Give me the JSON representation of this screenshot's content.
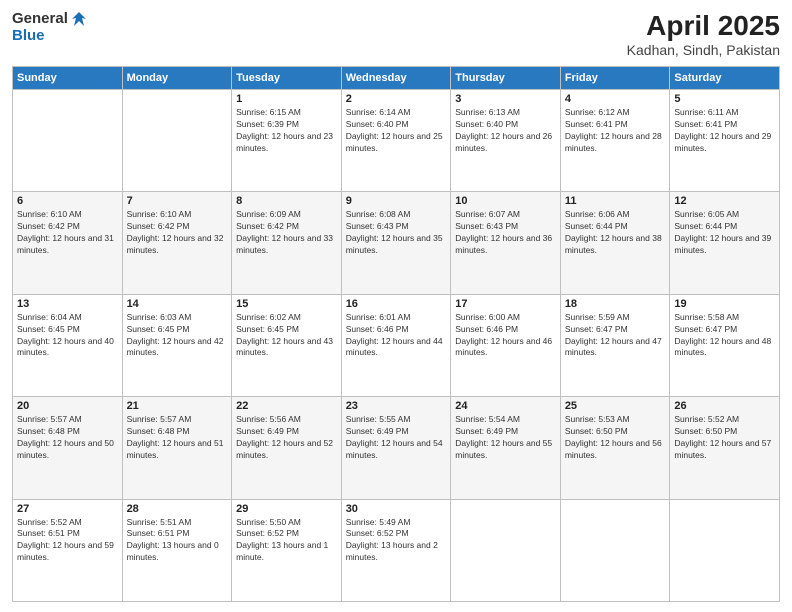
{
  "header": {
    "logo_general": "General",
    "logo_blue": "Blue",
    "title": "April 2025",
    "location": "Kadhan, Sindh, Pakistan"
  },
  "weekdays": [
    "Sunday",
    "Monday",
    "Tuesday",
    "Wednesday",
    "Thursday",
    "Friday",
    "Saturday"
  ],
  "weeks": [
    [
      {
        "day": "",
        "sunrise": "",
        "sunset": "",
        "daylight": ""
      },
      {
        "day": "",
        "sunrise": "",
        "sunset": "",
        "daylight": ""
      },
      {
        "day": "1",
        "sunrise": "Sunrise: 6:15 AM",
        "sunset": "Sunset: 6:39 PM",
        "daylight": "Daylight: 12 hours and 23 minutes."
      },
      {
        "day": "2",
        "sunrise": "Sunrise: 6:14 AM",
        "sunset": "Sunset: 6:40 PM",
        "daylight": "Daylight: 12 hours and 25 minutes."
      },
      {
        "day": "3",
        "sunrise": "Sunrise: 6:13 AM",
        "sunset": "Sunset: 6:40 PM",
        "daylight": "Daylight: 12 hours and 26 minutes."
      },
      {
        "day": "4",
        "sunrise": "Sunrise: 6:12 AM",
        "sunset": "Sunset: 6:41 PM",
        "daylight": "Daylight: 12 hours and 28 minutes."
      },
      {
        "day": "5",
        "sunrise": "Sunrise: 6:11 AM",
        "sunset": "Sunset: 6:41 PM",
        "daylight": "Daylight: 12 hours and 29 minutes."
      }
    ],
    [
      {
        "day": "6",
        "sunrise": "Sunrise: 6:10 AM",
        "sunset": "Sunset: 6:42 PM",
        "daylight": "Daylight: 12 hours and 31 minutes."
      },
      {
        "day": "7",
        "sunrise": "Sunrise: 6:10 AM",
        "sunset": "Sunset: 6:42 PM",
        "daylight": "Daylight: 12 hours and 32 minutes."
      },
      {
        "day": "8",
        "sunrise": "Sunrise: 6:09 AM",
        "sunset": "Sunset: 6:42 PM",
        "daylight": "Daylight: 12 hours and 33 minutes."
      },
      {
        "day": "9",
        "sunrise": "Sunrise: 6:08 AM",
        "sunset": "Sunset: 6:43 PM",
        "daylight": "Daylight: 12 hours and 35 minutes."
      },
      {
        "day": "10",
        "sunrise": "Sunrise: 6:07 AM",
        "sunset": "Sunset: 6:43 PM",
        "daylight": "Daylight: 12 hours and 36 minutes."
      },
      {
        "day": "11",
        "sunrise": "Sunrise: 6:06 AM",
        "sunset": "Sunset: 6:44 PM",
        "daylight": "Daylight: 12 hours and 38 minutes."
      },
      {
        "day": "12",
        "sunrise": "Sunrise: 6:05 AM",
        "sunset": "Sunset: 6:44 PM",
        "daylight": "Daylight: 12 hours and 39 minutes."
      }
    ],
    [
      {
        "day": "13",
        "sunrise": "Sunrise: 6:04 AM",
        "sunset": "Sunset: 6:45 PM",
        "daylight": "Daylight: 12 hours and 40 minutes."
      },
      {
        "day": "14",
        "sunrise": "Sunrise: 6:03 AM",
        "sunset": "Sunset: 6:45 PM",
        "daylight": "Daylight: 12 hours and 42 minutes."
      },
      {
        "day": "15",
        "sunrise": "Sunrise: 6:02 AM",
        "sunset": "Sunset: 6:45 PM",
        "daylight": "Daylight: 12 hours and 43 minutes."
      },
      {
        "day": "16",
        "sunrise": "Sunrise: 6:01 AM",
        "sunset": "Sunset: 6:46 PM",
        "daylight": "Daylight: 12 hours and 44 minutes."
      },
      {
        "day": "17",
        "sunrise": "Sunrise: 6:00 AM",
        "sunset": "Sunset: 6:46 PM",
        "daylight": "Daylight: 12 hours and 46 minutes."
      },
      {
        "day": "18",
        "sunrise": "Sunrise: 5:59 AM",
        "sunset": "Sunset: 6:47 PM",
        "daylight": "Daylight: 12 hours and 47 minutes."
      },
      {
        "day": "19",
        "sunrise": "Sunrise: 5:58 AM",
        "sunset": "Sunset: 6:47 PM",
        "daylight": "Daylight: 12 hours and 48 minutes."
      }
    ],
    [
      {
        "day": "20",
        "sunrise": "Sunrise: 5:57 AM",
        "sunset": "Sunset: 6:48 PM",
        "daylight": "Daylight: 12 hours and 50 minutes."
      },
      {
        "day": "21",
        "sunrise": "Sunrise: 5:57 AM",
        "sunset": "Sunset: 6:48 PM",
        "daylight": "Daylight: 12 hours and 51 minutes."
      },
      {
        "day": "22",
        "sunrise": "Sunrise: 5:56 AM",
        "sunset": "Sunset: 6:49 PM",
        "daylight": "Daylight: 12 hours and 52 minutes."
      },
      {
        "day": "23",
        "sunrise": "Sunrise: 5:55 AM",
        "sunset": "Sunset: 6:49 PM",
        "daylight": "Daylight: 12 hours and 54 minutes."
      },
      {
        "day": "24",
        "sunrise": "Sunrise: 5:54 AM",
        "sunset": "Sunset: 6:49 PM",
        "daylight": "Daylight: 12 hours and 55 minutes."
      },
      {
        "day": "25",
        "sunrise": "Sunrise: 5:53 AM",
        "sunset": "Sunset: 6:50 PM",
        "daylight": "Daylight: 12 hours and 56 minutes."
      },
      {
        "day": "26",
        "sunrise": "Sunrise: 5:52 AM",
        "sunset": "Sunset: 6:50 PM",
        "daylight": "Daylight: 12 hours and 57 minutes."
      }
    ],
    [
      {
        "day": "27",
        "sunrise": "Sunrise: 5:52 AM",
        "sunset": "Sunset: 6:51 PM",
        "daylight": "Daylight: 12 hours and 59 minutes."
      },
      {
        "day": "28",
        "sunrise": "Sunrise: 5:51 AM",
        "sunset": "Sunset: 6:51 PM",
        "daylight": "Daylight: 13 hours and 0 minutes."
      },
      {
        "day": "29",
        "sunrise": "Sunrise: 5:50 AM",
        "sunset": "Sunset: 6:52 PM",
        "daylight": "Daylight: 13 hours and 1 minute."
      },
      {
        "day": "30",
        "sunrise": "Sunrise: 5:49 AM",
        "sunset": "Sunset: 6:52 PM",
        "daylight": "Daylight: 13 hours and 2 minutes."
      },
      {
        "day": "",
        "sunrise": "",
        "sunset": "",
        "daylight": ""
      },
      {
        "day": "",
        "sunrise": "",
        "sunset": "",
        "daylight": ""
      },
      {
        "day": "",
        "sunrise": "",
        "sunset": "",
        "daylight": ""
      }
    ]
  ]
}
